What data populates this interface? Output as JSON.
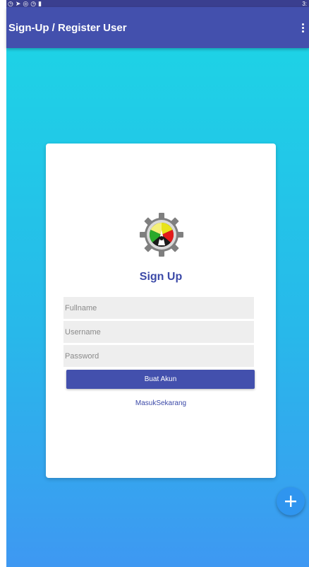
{
  "colors": {
    "app_bar": "#4350ad",
    "status_bar": "#3a3f8f",
    "gradient_top": "#1ed2e6",
    "gradient_bottom": "#3e98f2",
    "accent_text": "#3c4aa8",
    "button": "#4350ad",
    "fab": "#2f95ef"
  },
  "status_bar": {
    "icons": [
      "notification-icon",
      "telegram-icon",
      "messenger-icon",
      "whatsapp-icon",
      "lock-icon"
    ],
    "icons_text": "◷➤◎◷▮",
    "time": "3:"
  },
  "app_bar": {
    "title": "Sign-Up / Register User",
    "overflow_icon": "more-vert-icon"
  },
  "card": {
    "logo_icon": "gear-emblem-logo",
    "title": "Sign Up",
    "fullname": {
      "placeholder": "Fullname",
      "value": ""
    },
    "username": {
      "placeholder": "Username",
      "value": ""
    },
    "password": {
      "placeholder": "Password",
      "value": ""
    },
    "submit_label": "Buat Akun",
    "login_link": "MasukSekarang"
  },
  "fab": {
    "icon": "plus-icon"
  }
}
